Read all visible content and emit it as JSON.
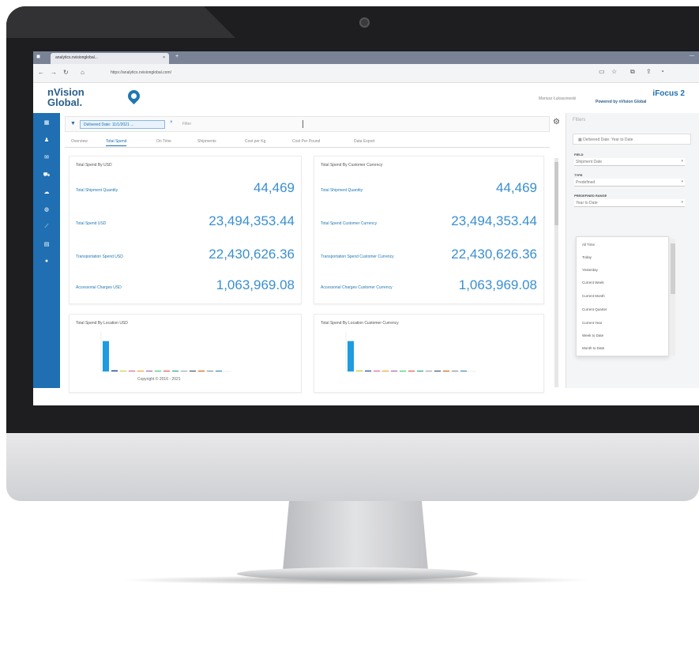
{
  "browser": {
    "tab_title": "analytics.nvisionglobal...",
    "url": "https://analytics.nvisionglobal.com/",
    "tab_close": "×",
    "new_tab": "+",
    "window_min": "—"
  },
  "app": {
    "logo_line1": "nVision",
    "logo_line2": "Global.",
    "user_name": "Mariusz Łukaszewski",
    "product": "iFocus 2",
    "powered_by": "Powered by nVision Global"
  },
  "filter": {
    "chip_label": "Delivered Date: 11/1/2021 ...",
    "chip_close": "×",
    "placeholder": "Filter"
  },
  "tabs": [
    {
      "label": "Overview"
    },
    {
      "label": "Total Spend"
    },
    {
      "label": "On Time"
    },
    {
      "label": "Shipments"
    },
    {
      "label": "Cost per Kg"
    },
    {
      "label": "Cost Per Pound"
    },
    {
      "label": "Data Export"
    }
  ],
  "cards": {
    "usd": {
      "title": "Total Spend By USD",
      "rows": [
        {
          "label": "Total Shipment Quantity",
          "value": "44,469"
        },
        {
          "label": "Total Spend USD",
          "value": "23,494,353.44"
        },
        {
          "label": "Transportation Spend USD",
          "value": "22,430,626.36"
        },
        {
          "label": "Accessorial Charges USD",
          "value": "1,063,969.08"
        }
      ]
    },
    "customer": {
      "title": "Total Spend By Customer Currency",
      "rows": [
        {
          "label": "Total Shipment Quantity",
          "value": "44,469"
        },
        {
          "label": "Total Spend Customer Currency",
          "value": "23,494,353.44"
        },
        {
          "label": "Transportation Spend Customer Currency",
          "value": "22,430,626.36"
        },
        {
          "label": "Accessorial Charges Customer Currency",
          "value": "1,063,969.08"
        }
      ]
    },
    "loc_usd": {
      "title": "Total Spend By Location USD"
    },
    "loc_cust": {
      "title": "Total Spend By Location Customer Currency"
    }
  },
  "copyright": "Copyright © 2016 - 2021",
  "right_panel": {
    "title": "Filters",
    "button": "Delivered Date: Year to Date",
    "field_label": "FIELD",
    "field_value": "Shipment Date",
    "type_label": "TYPE",
    "type_value": "Predefined",
    "range_label": "PREDEFINED RANGE",
    "range_value": "Year to Date",
    "options": [
      "All Time",
      "Today",
      "Yesterday",
      "Current Week",
      "Current Month",
      "Current Quarter",
      "Current Year",
      "Week to Date",
      "Month to Date"
    ]
  },
  "chart_data": [
    {
      "type": "bar",
      "title": "Total Spend By Location USD",
      "categories": [
        "",
        "",
        "",
        "",
        "",
        "",
        "",
        "",
        "",
        "",
        "",
        "",
        "",
        ""
      ],
      "values": [
        40,
        1.5,
        1.2,
        1,
        0.9,
        0.8,
        0.7,
        0.6,
        0.5,
        0.5,
        0.4,
        0.4,
        0.3,
        0.3
      ],
      "ylim": [
        0,
        50
      ],
      "colors": [
        "#1f9be0",
        "#1f4e8c",
        "#c8d64a",
        "#e0569a",
        "#f39c12",
        "#9b59b6",
        "#2ecc71",
        "#e74c3c",
        "#16a085",
        "#95a5a6",
        "#34495e",
        "#d35400",
        "#7f8c8d",
        "#2980b9"
      ]
    },
    {
      "type": "bar",
      "title": "Total Spend By Location Customer Currency",
      "categories": [
        "",
        "",
        "",
        "",
        "",
        "",
        "",
        "",
        "",
        "",
        "",
        "",
        "",
        ""
      ],
      "values": [
        40,
        1.5,
        1.2,
        1,
        0.9,
        0.8,
        0.7,
        0.6,
        0.5,
        0.5,
        0.4,
        0.4,
        0.3,
        0.3
      ],
      "ylim": [
        0,
        50
      ],
      "colors": [
        "#1f9be0",
        "#c8d64a",
        "#1f4e8c",
        "#e0569a",
        "#f39c12",
        "#9b59b6",
        "#2ecc71",
        "#e74c3c",
        "#16a085",
        "#95a5a6",
        "#34495e",
        "#d35400",
        "#7f8c8d",
        "#2980b9"
      ]
    }
  ]
}
